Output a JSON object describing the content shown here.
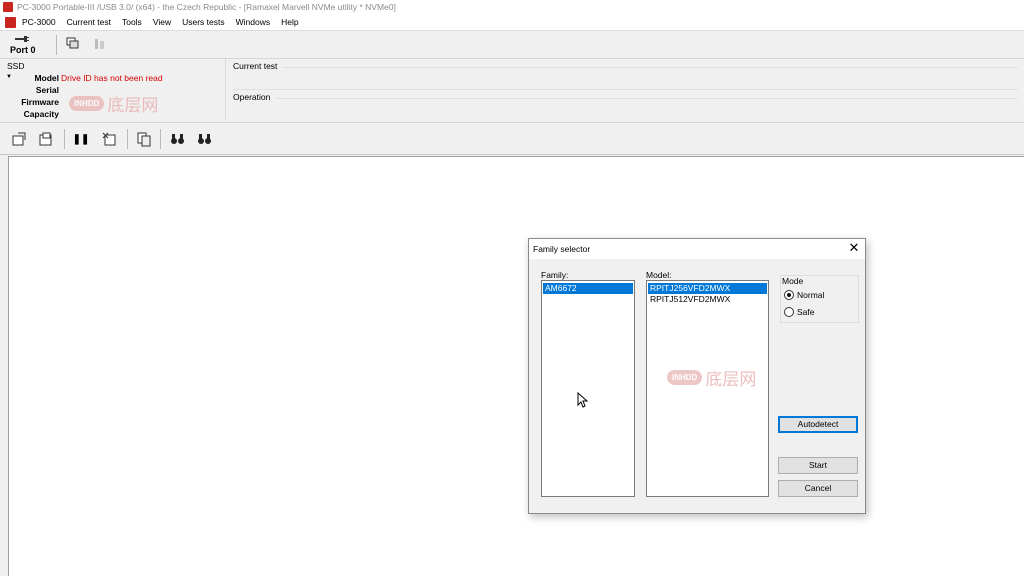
{
  "titlebar": {
    "title": "PC-3000 Portable-III /USB 3.0/ (x64) - the Czech Republic - [Ramaxel Marvell NVMe utility * NVMe0]"
  },
  "menubar": {
    "items": [
      "PC-3000",
      "Current test",
      "Tools",
      "View",
      "Users tests",
      "Windows",
      "Help"
    ]
  },
  "toolbar": {
    "port_label": "Port 0"
  },
  "info": {
    "ssd_header": "SSD",
    "fields": [
      {
        "label": "Model",
        "value": "Drive ID has not been read"
      },
      {
        "label": "Serial",
        "value": ""
      },
      {
        "label": "Firmware",
        "value": ""
      },
      {
        "label": "Capacity",
        "value": ""
      }
    ],
    "current_test_label": "Current test",
    "operation_label": "Operation"
  },
  "watermark": {
    "logo": "INHDD",
    "text": "底层网"
  },
  "dialog": {
    "title": "Family selector",
    "family_label": "Family:",
    "families": [
      "AM6672"
    ],
    "selected_family": 0,
    "model_label": "Model:",
    "models": [
      "RPITJ256VFD2MWX",
      "RPITJ512VFD2MWX"
    ],
    "selected_model": 0,
    "mode_label": "Mode",
    "modes": [
      "Normal",
      "Safe"
    ],
    "selected_mode": "Normal",
    "autodetect_label": "Autodetect",
    "start_label": "Start",
    "cancel_label": "Cancel"
  },
  "colors": {
    "accent": "#0078d7",
    "error_text": "#d40000",
    "app_icon": "#c8261e"
  }
}
